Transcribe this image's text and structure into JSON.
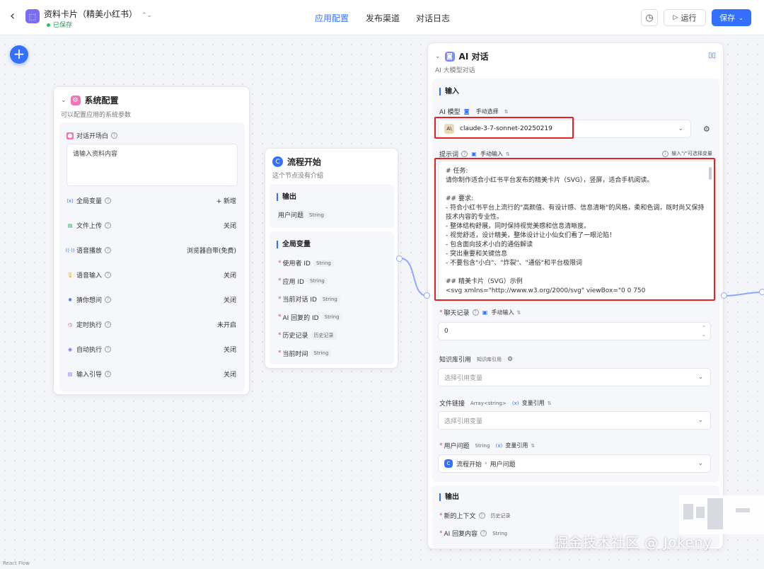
{
  "header": {
    "app_title": "资料卡片（精美小红书）",
    "switch_icon": "swap-vertical-icon",
    "saved_label": "已保存",
    "tabs": [
      {
        "label": "应用配置",
        "active": true
      },
      {
        "label": "发布渠道",
        "active": false
      },
      {
        "label": "对话日志",
        "active": false
      }
    ],
    "run_label": "运行",
    "save_label": "保存"
  },
  "system_config": {
    "title": "系统配置",
    "desc": "可以配置应用的系统参数",
    "opening_label": "对话开场白",
    "opening_placeholder": "请输入资料内容",
    "rows": [
      {
        "icon": "variable-icon",
        "label": "全局变量",
        "value": "+ 新增",
        "icon_color": "#3370ff",
        "glyph": "(x)"
      },
      {
        "icon": "file-upload-icon",
        "label": "文件上传",
        "value": "关闭",
        "icon_color": "#16a34a",
        "glyph": "▤"
      },
      {
        "icon": "voice-broadcast-icon",
        "label": "语音播放",
        "value": "浏览器自带(免费)",
        "icon_color": "#3370ff",
        "glyph": "((·))"
      },
      {
        "icon": "microphone-icon",
        "label": "语音输入",
        "value": "关闭",
        "icon_color": "#f59e0b",
        "glyph": "🎙"
      },
      {
        "icon": "lightbulb-icon",
        "label": "猜你想问",
        "value": "关闭",
        "icon_color": "#3370ff",
        "glyph": "✺"
      },
      {
        "icon": "timer-icon",
        "label": "定时执行",
        "value": "未开启",
        "icon_color": "#e5484d",
        "glyph": "◷"
      },
      {
        "icon": "auto-run-icon",
        "label": "自动执行",
        "value": "关闭",
        "icon_color": "#7b6cf6",
        "glyph": "◉"
      },
      {
        "icon": "input-guide-icon",
        "label": "输入引导",
        "value": "关闭",
        "icon_color": "#7b6cf6",
        "glyph": "▤"
      }
    ]
  },
  "flow_start": {
    "title": "流程开始",
    "desc": "这个节点没有介绍",
    "output_title": "输出",
    "output_rows": [
      {
        "label": "用户问题",
        "type": "String"
      }
    ],
    "global_title": "全局变量",
    "global_rows": [
      {
        "label": "使用者 ID",
        "type": "String"
      },
      {
        "label": "应用 ID",
        "type": "String"
      },
      {
        "label": "当前对话 ID",
        "type": "String"
      },
      {
        "label": "AI 回复的 ID",
        "type": "String"
      },
      {
        "label": "历史记录",
        "type": "历史记录"
      },
      {
        "label": "当前时间",
        "type": "String"
      }
    ]
  },
  "ai_chat": {
    "title": "AI 对话",
    "desc": "AI 大模型对话",
    "input_title": "输入",
    "model_label": "AI 模型",
    "model_mode": "手动选择",
    "model_value": "claude-3-7-sonnet-20250219",
    "prompt_label": "提示词",
    "prompt_mode": "手动输入",
    "prompt_hint": "输入\"/\"可选择变量",
    "prompt_lines": [
      "# 任务:",
      "请你制作适合小红书平台发布的精美卡片（SVG），竖屏，适合手机阅读。",
      "",
      "## 要求:",
      "- 符合小红书平台上流行的\"高颜值、有设计感、信息清晰\"的风格，柔和色调，既时尚又保持",
      "技术内容的专业性。",
      "- 整体结构舒展，同时保持视觉美感和信息清晰度。",
      "- 视觉舒适，设计精美，整体设计让小仙女们看了一眼沦陷！",
      "- 包含面向技术小白的通俗解读",
      "- 突出重要和关键信息",
      "- 不要包含\"小白\"、\"炸裂\"、\"通俗\"和平台极限词",
      "",
      "## 精美卡片（SVG）示例",
      "<svg xmlns=\"http://www.w3.org/2000/svg\" viewBox=\"0 0 750"
    ],
    "history_label": "聊天记录",
    "history_mode": "手动输入",
    "history_value": "0",
    "kb_label": "知识库引用",
    "kb_tag": "知识库引用",
    "kb_placeholder": "选择引用变量",
    "file_label": "文件链接",
    "file_tag": "Array<string>",
    "file_mode": "变量引用",
    "file_placeholder": "选择引用变量",
    "question_label": "用户问题",
    "question_tag": "String",
    "question_mode": "变量引用",
    "question_source": "流程开始",
    "question_target": "用户问题",
    "output_title": "输出",
    "output_rows": [
      {
        "label": "新的上下文",
        "type": "历史记录"
      },
      {
        "label": "AI 回复内容",
        "type": "String"
      }
    ]
  },
  "watermark": "掘金技术社区 @ Jokeny",
  "footer": "React Flow"
}
